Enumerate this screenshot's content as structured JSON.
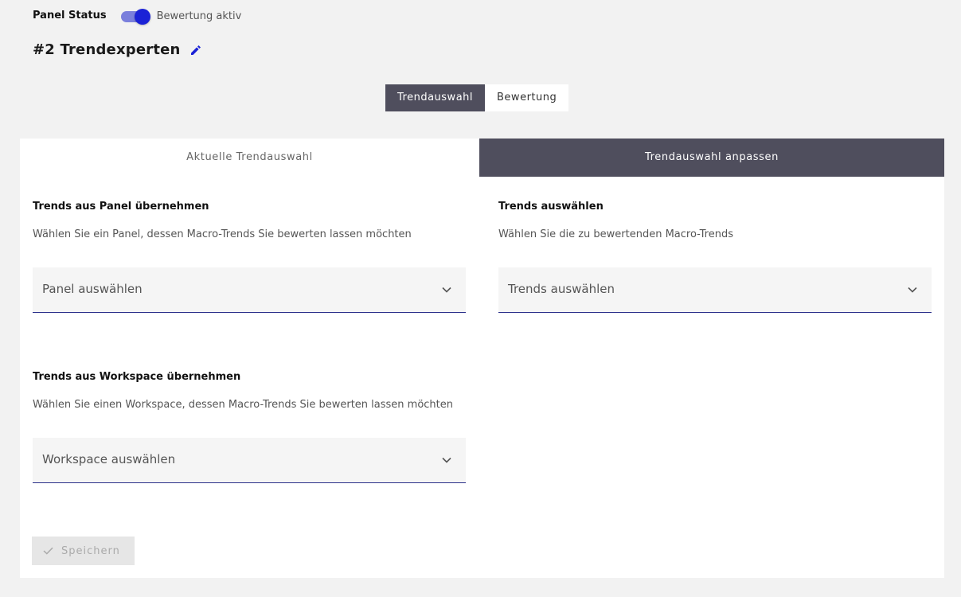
{
  "status": {
    "label": "Panel Status",
    "toggle_text": "Bewertung aktiv",
    "toggle_on": true
  },
  "page": {
    "title": "#2 Trendexperten"
  },
  "segment_tabs": [
    {
      "label": "Trendauswahl",
      "active": true
    },
    {
      "label": "Bewertung",
      "active": false
    }
  ],
  "card_tabs": [
    {
      "label": "Aktuelle Trendauswahl",
      "active": false
    },
    {
      "label": "Trendauswahl anpassen",
      "active": true
    }
  ],
  "panel_section": {
    "title": "Trends aus Panel übernehmen",
    "description": "Wählen Sie ein Panel, dessen Macro-Trends Sie bewerten lassen möchten",
    "select_placeholder": "Panel auswählen"
  },
  "trends_section": {
    "title": "Trends auswählen",
    "description": "Wählen Sie die zu bewertenden Macro-Trends",
    "select_placeholder": "Trends auswählen"
  },
  "workspace_section": {
    "title": "Trends aus Workspace übernehmen",
    "description": "Wählen Sie einen Workspace, dessen Macro-Trends Sie bewerten lassen möchten",
    "select_placeholder": "Workspace auswählen"
  },
  "save_button": {
    "label": "Speichern",
    "icon": "check-icon",
    "disabled": true
  },
  "colors": {
    "accent": "#1b22d6",
    "dark_tab": "#4f4e5d",
    "underline": "#2a2f8a",
    "background": "#f2f2f2"
  }
}
